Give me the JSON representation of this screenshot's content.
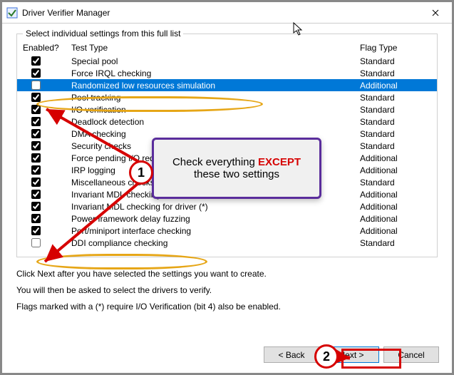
{
  "window": {
    "title": "Driver Verifier Manager"
  },
  "group": {
    "label": "Select individual settings from this full list",
    "columns": {
      "enabled": "Enabled?",
      "test": "Test Type",
      "flag": "Flag Type"
    }
  },
  "rows": [
    {
      "checked": true,
      "test": "Special pool",
      "flag": "Standard",
      "selected": false
    },
    {
      "checked": true,
      "test": "Force IRQL checking",
      "flag": "Standard",
      "selected": false
    },
    {
      "checked": false,
      "test": "Randomized low resources simulation",
      "flag": "Additional",
      "selected": true
    },
    {
      "checked": true,
      "test": "Pool tracking",
      "flag": "Standard",
      "selected": false
    },
    {
      "checked": true,
      "test": "I/O verification",
      "flag": "Standard",
      "selected": false
    },
    {
      "checked": true,
      "test": "Deadlock detection",
      "flag": "Standard",
      "selected": false
    },
    {
      "checked": true,
      "test": "DMA checking",
      "flag": "Standard",
      "selected": false
    },
    {
      "checked": true,
      "test": "Security checks",
      "flag": "Standard",
      "selected": false
    },
    {
      "checked": true,
      "test": "Force pending I/O requests",
      "flag": "Additional",
      "selected": false
    },
    {
      "checked": true,
      "test": "IRP logging",
      "flag": "Additional",
      "selected": false
    },
    {
      "checked": true,
      "test": "Miscellaneous checks",
      "flag": "Standard",
      "selected": false
    },
    {
      "checked": true,
      "test": "Invariant MDL checking for stack",
      "flag": "Additional",
      "selected": false
    },
    {
      "checked": true,
      "test": "Invariant MDL checking for driver (*)",
      "flag": "Additional",
      "selected": false
    },
    {
      "checked": true,
      "test": "Power framework delay fuzzing",
      "flag": "Additional",
      "selected": false
    },
    {
      "checked": true,
      "test": "Port/miniport interface checking",
      "flag": "Additional",
      "selected": false
    },
    {
      "checked": false,
      "test": "DDI compliance checking",
      "flag": "Standard",
      "selected": false
    }
  ],
  "instructions": {
    "line1": "Click Next after you have selected the settings you want to create.",
    "line2": "You will then be asked to select the drivers to verify.",
    "line3": "Flags marked with a (*) require I/O Verification (bit 4) also be enabled."
  },
  "buttons": {
    "back": "< Back",
    "next": "Next >",
    "cancel": "Cancel"
  },
  "annotation": {
    "callout_pre": "Check everything ",
    "callout_except": "EXCEPT",
    "callout_post": "these two settings",
    "badge1": "1",
    "badge2": "2"
  }
}
